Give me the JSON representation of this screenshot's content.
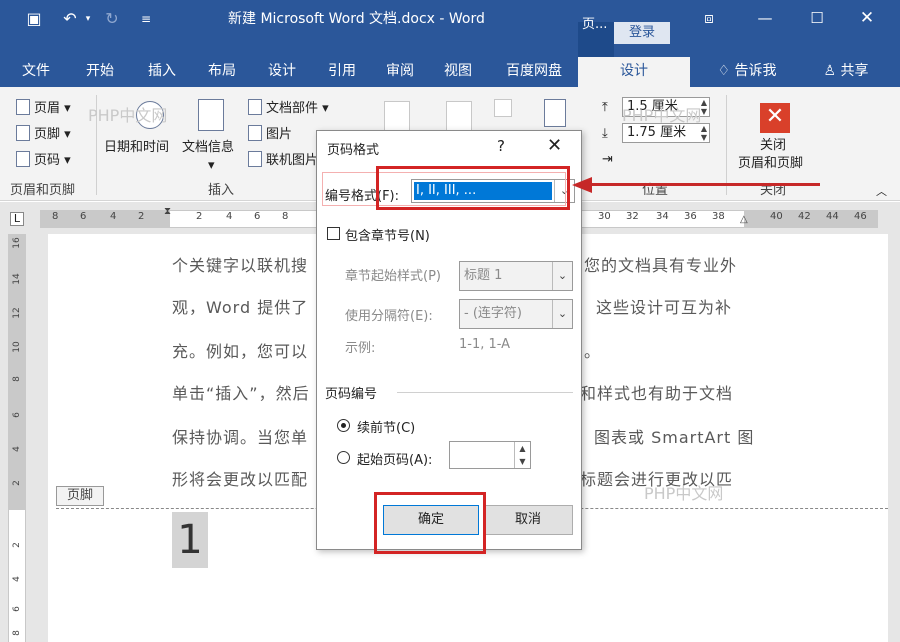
{
  "window": {
    "title": "新建 Microsoft Word 文档.docx  -  Word",
    "context_tab": "页...",
    "login": "登录"
  },
  "tabs": [
    "文件",
    "开始",
    "插入",
    "布局",
    "设计",
    "引用",
    "审阅",
    "视图",
    "百度网盘",
    "设计",
    "告诉我",
    "共享"
  ],
  "ribbon": {
    "header_footer": [
      "页眉",
      "页脚",
      "页码"
    ],
    "date_time": "日期和时间",
    "doc_info": "文档信息",
    "doc_parts": "文档部件",
    "picture": "图片",
    "online_picture": "联机图片",
    "group_header_footer": "页眉和页脚",
    "group_insert": "插入",
    "group_position": "位置",
    "group_close": "关闭",
    "header_top": "1.5 厘米",
    "footer_bottom": "1.75 厘米",
    "close_label_1": "关闭",
    "close_label_2": "页眉和页脚"
  },
  "ruler_ticks": [
    "8",
    "6",
    "4",
    "2",
    "2",
    "4",
    "6",
    "8",
    "30",
    "32",
    "34",
    "36",
    "38",
    "40",
    "42",
    "44",
    "46",
    "48"
  ],
  "vruler_ticks": [
    "16",
    "14",
    "12",
    "10",
    "8",
    "6",
    "4",
    "2",
    "2",
    "4",
    "6",
    "8"
  ],
  "document": {
    "line1_left": "个关键字以联机搜",
    "line1_right": "您的文档具有专业外",
    "line2_left": "观，Word 提供了",
    "line2_right": "这些设计可互为补",
    "line3_left": "充。例如，您可以",
    "line3_right": "。",
    "line4_left": "单击“插入”，然后",
    "line4_right": "和样式也有助于文档",
    "line5_left": "保持协调。当您单",
    "line5_right": "图表或 SmartArt 图",
    "line6_left": "形将会更改以匹配",
    "line6_right": "标题会进行更改以匹",
    "footer_tag": "页脚",
    "page_number": "1",
    "watermark": "PHP中文网"
  },
  "dialog": {
    "title": "页码格式",
    "help": "?",
    "close": "✕",
    "number_format_label": "编号格式(F):",
    "number_format_value": "I, II, III, ...",
    "include_chapter_label": "包含章节号(N)",
    "chapter_style_label": "章节起始样式(P)",
    "chapter_style_value": "标题 1",
    "separator_label": "使用分隔符(E):",
    "separator_value": "-  (连字符)",
    "example_label": "示例:",
    "example_value": "1-1, 1-A",
    "page_numbering_label": "页码编号",
    "continue_label": "续前节(C)",
    "start_at_label": "起始页码(A):",
    "ok": "确定",
    "cancel": "取消"
  }
}
